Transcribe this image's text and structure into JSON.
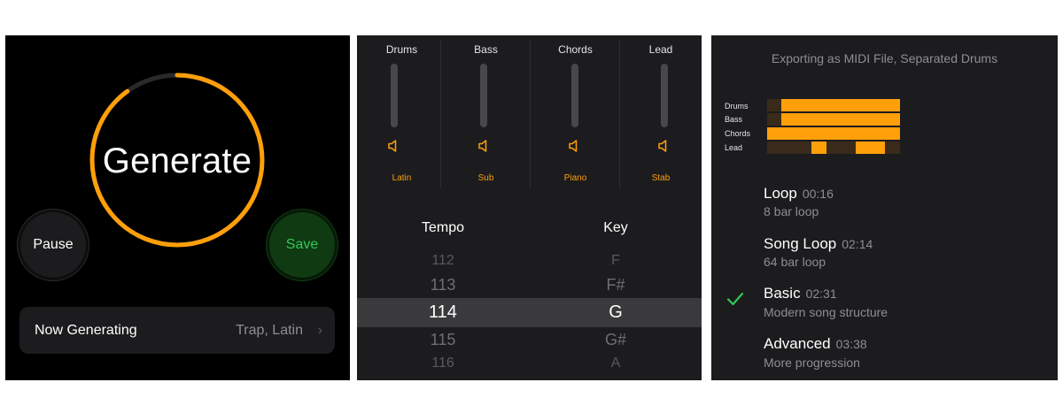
{
  "colors": {
    "accent": "#ff9f0a",
    "save_green": "#34c759",
    "muted": "#8e8e93"
  },
  "generate_screen": {
    "generate_label": "Generate",
    "progress": 0.9,
    "pause_label": "Pause",
    "save_label": "Save",
    "now_generating": {
      "title": "Now Generating",
      "value": "Trap, Latin",
      "chevron_icon": "chevron-right-icon"
    }
  },
  "mixer_screen": {
    "tracks": [
      {
        "name": "Drums",
        "sound": "Latin",
        "icon": "speaker-icon"
      },
      {
        "name": "Bass",
        "sound": "Sub",
        "icon": "speaker-icon"
      },
      {
        "name": "Chords",
        "sound": "Piano",
        "icon": "speaker-icon"
      },
      {
        "name": "Lead",
        "sound": "Stab",
        "icon": "speaker-icon"
      }
    ],
    "tempo": {
      "header": "Tempo",
      "options": [
        "112",
        "113",
        "114",
        "115",
        "116"
      ],
      "selected": "114"
    },
    "key": {
      "header": "Key",
      "options": [
        "F",
        "F#",
        "G",
        "G#",
        "A"
      ],
      "selected": "G"
    }
  },
  "export_screen": {
    "title": "Exporting as MIDI File, Separated Drums",
    "lanes": [
      "Drums",
      "Bass",
      "Chords",
      "Lead"
    ],
    "options": [
      {
        "title": "Loop",
        "duration": "00:16",
        "subtitle": "8 bar loop",
        "selected": false
      },
      {
        "title": "Song Loop",
        "duration": "02:14",
        "subtitle": "64 bar loop",
        "selected": false
      },
      {
        "title": "Basic",
        "duration": "02:31",
        "subtitle": "Modern song structure",
        "selected": true
      },
      {
        "title": "Advanced",
        "duration": "03:38",
        "subtitle": "More progression",
        "selected": false
      }
    ],
    "check_icon": "checkmark-icon"
  }
}
